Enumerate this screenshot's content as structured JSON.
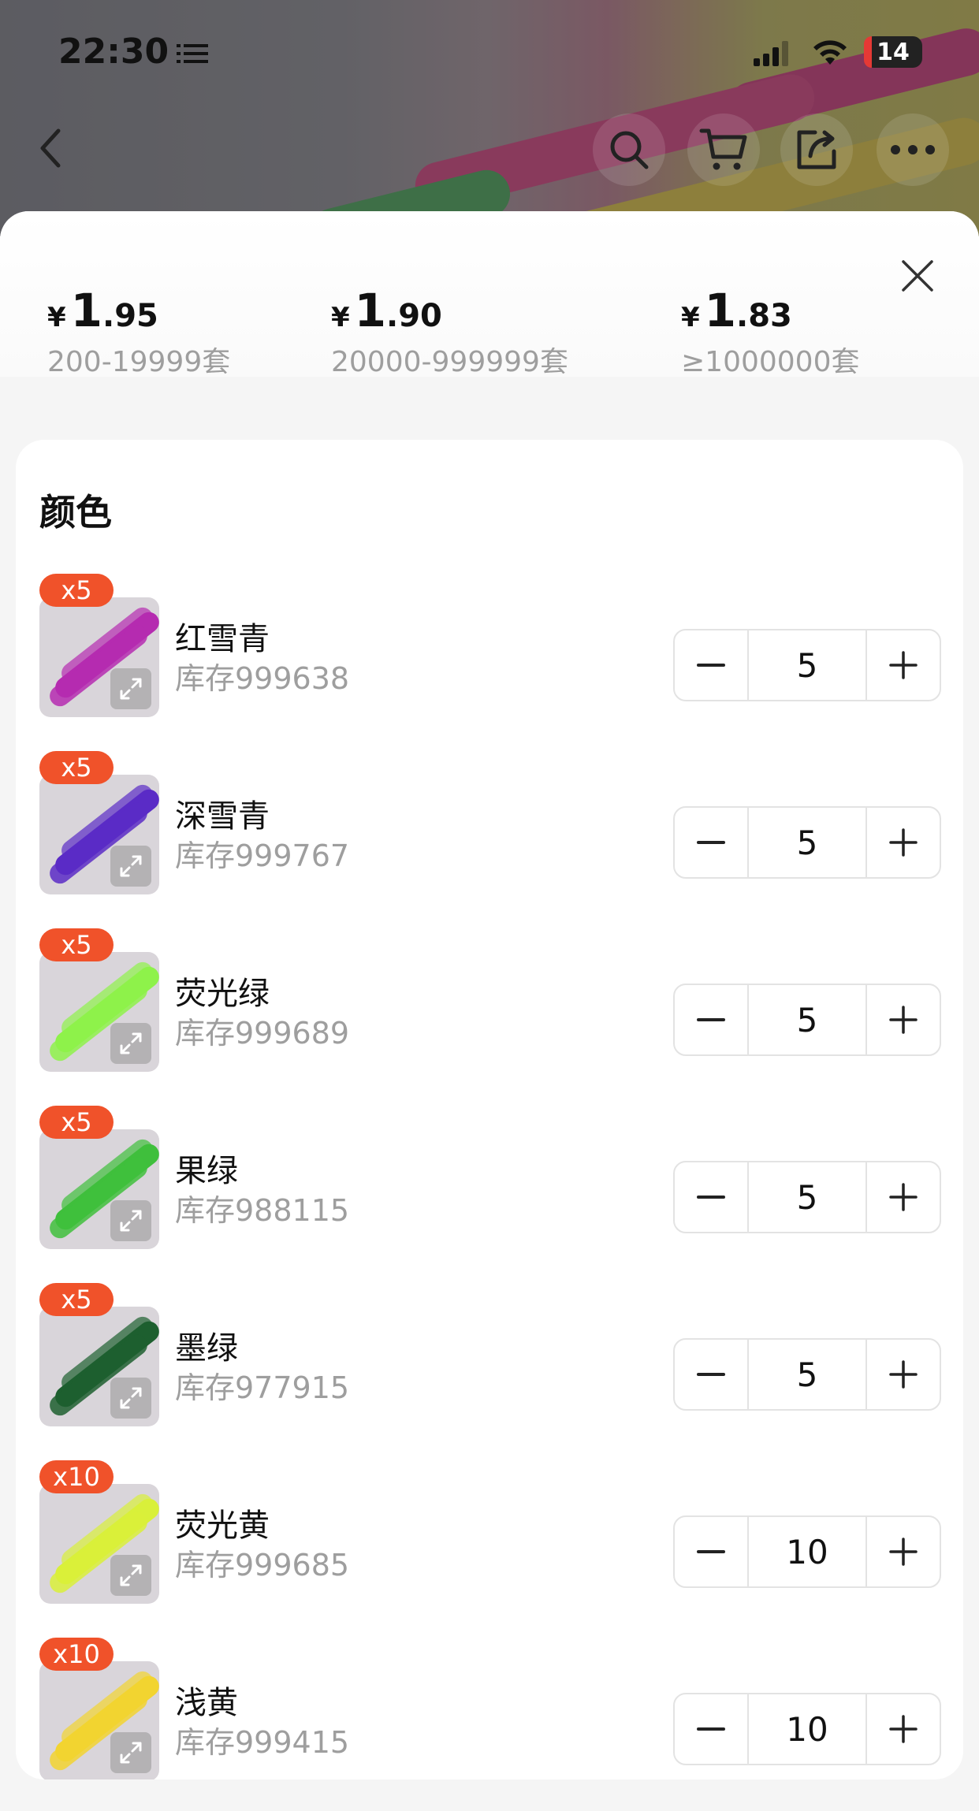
{
  "status_bar": {
    "time": "22:30",
    "battery": "14"
  },
  "nav": {
    "icons": [
      "back-icon",
      "search-icon",
      "cart-icon",
      "share-icon",
      "more-icon"
    ]
  },
  "price_tiers": [
    {
      "currency": "¥",
      "integer": "1",
      "decimal": ".95",
      "range": "200-19999套"
    },
    {
      "currency": "¥",
      "integer": "1",
      "decimal": ".90",
      "range": "20000-999999套"
    },
    {
      "currency": "¥",
      "integer": "1",
      "decimal": ".83",
      "range": "≥1000000套"
    }
  ],
  "section": {
    "title": "颜色"
  },
  "items": [
    {
      "multiplier": "x5",
      "name": "红雪青",
      "stock": "库存999638",
      "quantity": "5",
      "color": "#b52bb0"
    },
    {
      "multiplier": "x5",
      "name": "深雪青",
      "stock": "库存999767",
      "quantity": "5",
      "color": "#5a2bc6"
    },
    {
      "multiplier": "x5",
      "name": "荧光绿",
      "stock": "库存999689",
      "quantity": "5",
      "color": "#8ef24a"
    },
    {
      "multiplier": "x5",
      "name": "果绿",
      "stock": "库存988115",
      "quantity": "5",
      "color": "#3fbf3c"
    },
    {
      "multiplier": "x5",
      "name": "墨绿",
      "stock": "库存977915",
      "quantity": "5",
      "color": "#1d5f2f"
    },
    {
      "multiplier": "x10",
      "name": "荧光黄",
      "stock": "库存999685",
      "quantity": "10",
      "color": "#d9f03a"
    },
    {
      "multiplier": "x10",
      "name": "浅黄",
      "stock": "库存999415",
      "quantity": "10",
      "color": "#f2d430"
    }
  ],
  "colors": {
    "accent": "#f0522a",
    "muted_text": "#9e9e9e"
  }
}
